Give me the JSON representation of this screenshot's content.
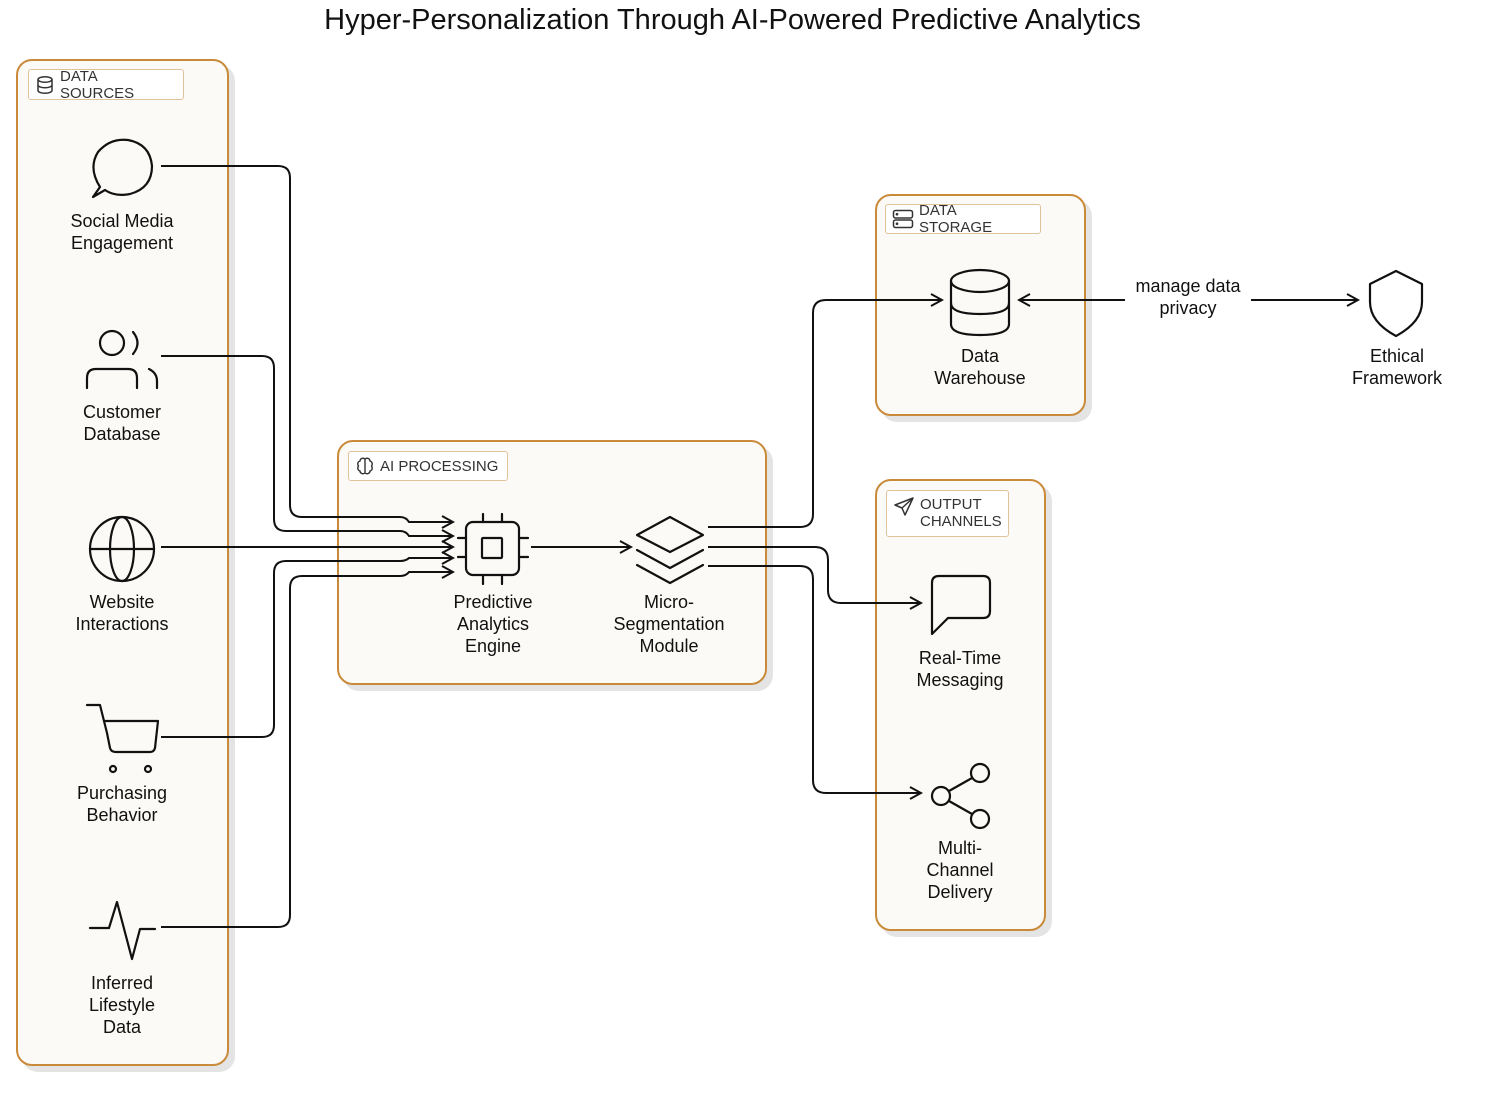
{
  "title": "Hyper-Personalization Through AI-Powered Predictive Analytics",
  "groups": {
    "data_sources": {
      "label": "DATA SOURCES",
      "icon": "database-icon"
    },
    "ai_processing": {
      "label": "AI PROCESSING",
      "icon": "brain-icon"
    },
    "data_storage": {
      "label": "DATA STORAGE",
      "icon": "server-icon"
    },
    "output_channels": {
      "label": "OUTPUT\nCHANNELS",
      "icon": "send-icon"
    }
  },
  "nodes": {
    "social_media": {
      "label": "Social Media\nEngagement",
      "icon": "chat-bubble-icon"
    },
    "customer_db": {
      "label": "Customer\nDatabase",
      "icon": "users-icon"
    },
    "website": {
      "label": "Website\nInteractions",
      "icon": "globe-icon"
    },
    "purchasing": {
      "label": "Purchasing\nBehavior",
      "icon": "shopping-cart-icon"
    },
    "lifestyle": {
      "label": "Inferred\nLifestyle\nData",
      "icon": "activity-icon"
    },
    "predictive": {
      "label": "Predictive\nAnalytics\nEngine",
      "icon": "cpu-icon"
    },
    "segmentation": {
      "label": "Micro-\nSegmentation\nModule",
      "icon": "layers-icon"
    },
    "warehouse": {
      "label": "Data\nWarehouse",
      "icon": "database-cylinder-icon"
    },
    "ethical": {
      "label": "Ethical\nFramework",
      "icon": "shield-icon"
    },
    "messaging": {
      "label": "Real-Time\nMessaging",
      "icon": "message-square-icon"
    },
    "multichannel": {
      "label": "Multi-\nChannel\nDelivery",
      "icon": "share-icon"
    }
  },
  "edges": [
    {
      "from": "social_media",
      "to": "predictive",
      "label": ""
    },
    {
      "from": "customer_db",
      "to": "predictive",
      "label": ""
    },
    {
      "from": "website",
      "to": "predictive",
      "label": ""
    },
    {
      "from": "purchasing",
      "to": "predictive",
      "label": ""
    },
    {
      "from": "lifestyle",
      "to": "predictive",
      "label": ""
    },
    {
      "from": "predictive",
      "to": "segmentation",
      "label": ""
    },
    {
      "from": "segmentation",
      "to": "warehouse",
      "label": ""
    },
    {
      "from": "segmentation",
      "to": "messaging",
      "label": ""
    },
    {
      "from": "segmentation",
      "to": "multichannel",
      "label": ""
    },
    {
      "from": "warehouse",
      "to": "ethical",
      "label": "manage data\nprivacy",
      "bidirectional": true
    }
  ],
  "colors": {
    "group_border": "#c98a3a",
    "group_fill": "#fbfaf6",
    "stroke": "#111111"
  }
}
